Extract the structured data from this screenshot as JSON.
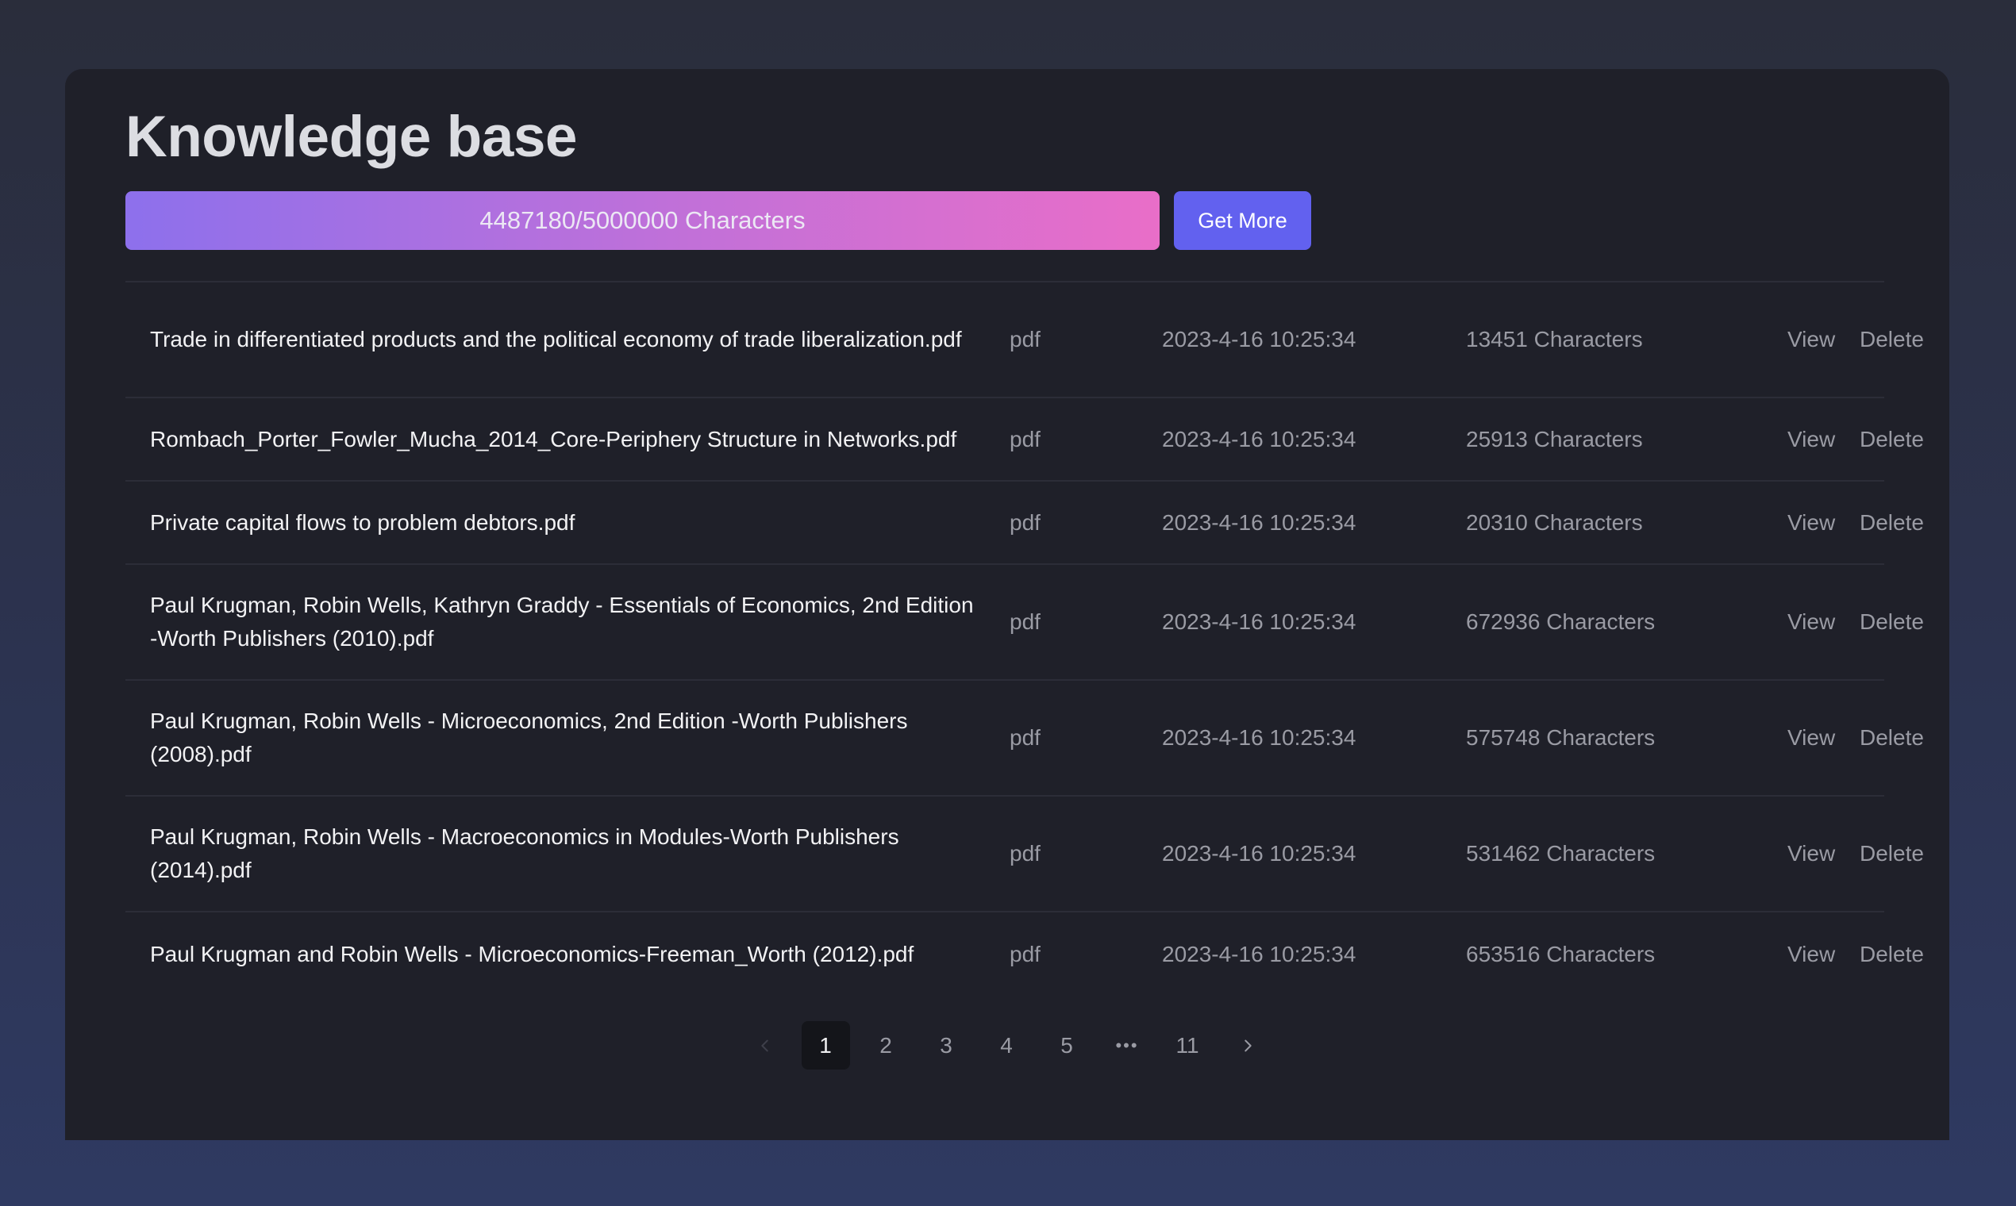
{
  "header": {
    "title": "Knowledge base"
  },
  "usage": {
    "used": 4487180,
    "limit": 5000000,
    "fraction": 0.897,
    "label": "4487180/5000000 Characters",
    "button_label": "Get More"
  },
  "files": [
    {
      "name": "Trade in differentiated products and the political economy of trade liberalization.pdf",
      "type": "pdf",
      "date": "2023-4-16 10:25:34",
      "chars": "13451 Characters",
      "view": "View",
      "delete": "Delete"
    },
    {
      "name": "Rombach_Porter_Fowler_Mucha_2014_Core-Periphery Structure in Networks.pdf",
      "type": "pdf",
      "date": "2023-4-16 10:25:34",
      "chars": "25913 Characters",
      "view": "View",
      "delete": "Delete"
    },
    {
      "name": "Private capital flows to problem debtors.pdf",
      "type": "pdf",
      "date": "2023-4-16 10:25:34",
      "chars": "20310 Characters",
      "view": "View",
      "delete": "Delete"
    },
    {
      "name": "Paul Krugman, Robin Wells, Kathryn Graddy - Essentials of Economics, 2nd Edition -Worth Publishers (2010).pdf",
      "type": "pdf",
      "date": "2023-4-16 10:25:34",
      "chars": "672936 Characters",
      "view": "View",
      "delete": "Delete"
    },
    {
      "name": "Paul Krugman, Robin Wells - Microeconomics, 2nd Edition -Worth Publishers (2008).pdf",
      "type": "pdf",
      "date": "2023-4-16 10:25:34",
      "chars": "575748 Characters",
      "view": "View",
      "delete": "Delete"
    },
    {
      "name": "Paul Krugman, Robin Wells - Macroeconomics in Modules-Worth Publishers (2014).pdf",
      "type": "pdf",
      "date": "2023-4-16 10:25:34",
      "chars": "531462 Characters",
      "view": "View",
      "delete": "Delete"
    },
    {
      "name": "Paul Krugman and Robin Wells - Microeconomics-Freeman_Worth (2012).pdf",
      "type": "pdf",
      "date": "2023-4-16 10:25:34",
      "chars": "653516 Characters",
      "view": "View",
      "delete": "Delete"
    }
  ],
  "pagination": {
    "pages": [
      "1",
      "2",
      "3",
      "4",
      "5"
    ],
    "ellipsis": "•••",
    "last": "11",
    "current": "1",
    "prev_icon": "chevron-left-icon",
    "next_icon": "chevron-right-icon"
  },
  "colors": {
    "accent": "#6261ef",
    "bar_start": "#8d70ec",
    "bar_end": "#e96ec8",
    "panel": "#1f2029"
  }
}
